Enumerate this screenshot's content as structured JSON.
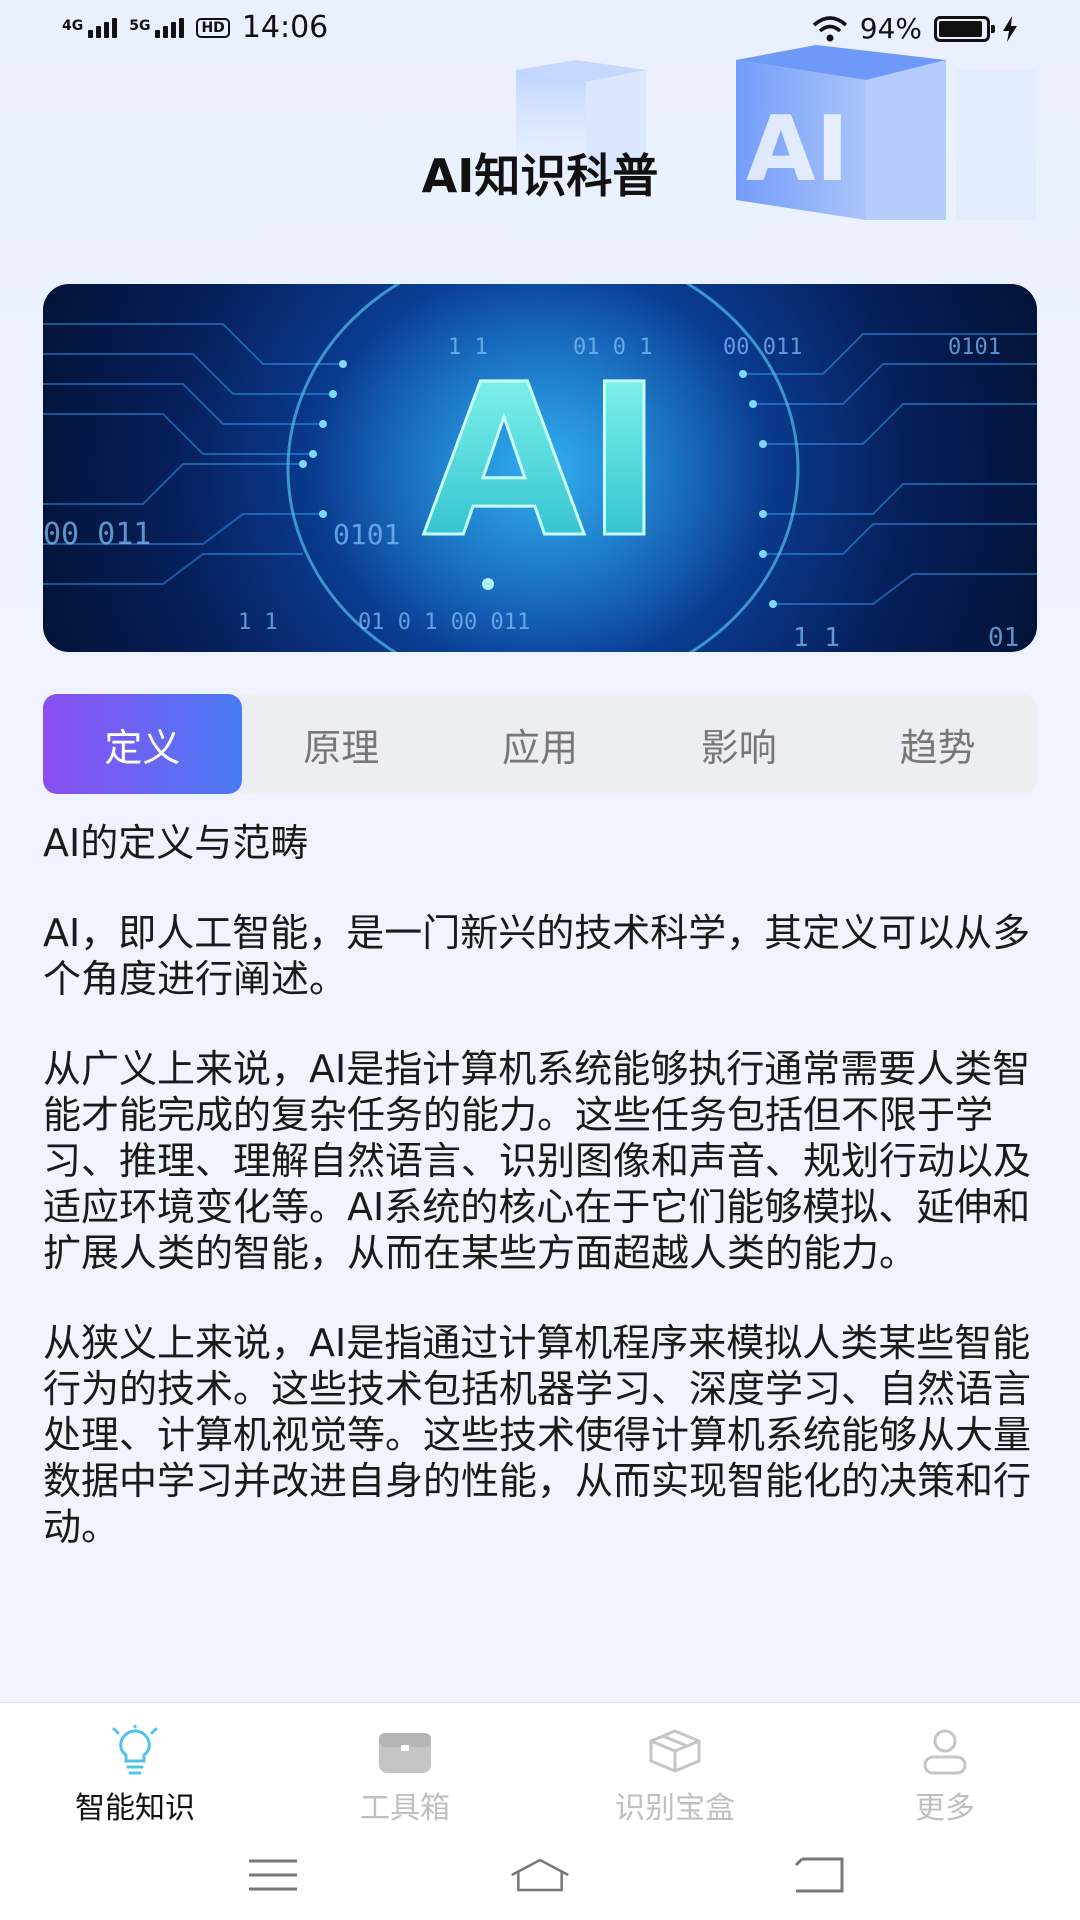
{
  "status_bar": {
    "net1": "4G",
    "net2": "5G",
    "hd": "HD",
    "time": "14:06",
    "battery_pct": "94%",
    "battery_level": 0.94
  },
  "header": {
    "title": "AI知识科普"
  },
  "banner": {
    "main_text": "AI",
    "binary": [
      "1 1",
      "01 0 1",
      "00 011",
      "0101",
      "00 011",
      "0101",
      "1 1",
      "01 0 1 00 011",
      "1 1",
      "01"
    ]
  },
  "tabs": [
    {
      "label": "定义",
      "active": true
    },
    {
      "label": "原理",
      "active": false
    },
    {
      "label": "应用",
      "active": false
    },
    {
      "label": "影响",
      "active": false
    },
    {
      "label": "趋势",
      "active": false
    }
  ],
  "article": {
    "heading": "AI的定义与范畴",
    "paragraphs": [
      "AI，即人工智能，是一门新兴的技术科学，其定义可以从多个角度进行阐述。",
      "从广义上来说，AI是指计算机系统能够执行通常需要人类智能才能完成的复杂任务的能力。这些任务包括但不限于学习、推理、理解自然语言、识别图像和声音、规划行动以及适应环境变化等。AI系统的核心在于它们能够模拟、延伸和扩展人类的智能，从而在某些方面超越人类的能力。",
      "从狭义上来说，AI是指通过计算机程序来模拟人类某些智能行为的技术。这些技术包括机器学习、深度学习、自然语言处理、计算机视觉等。这些技术使得计算机系统能够从大量数据中学习并改进自身的性能，从而实现智能化的决策和行动。"
    ]
  },
  "bottom_nav": [
    {
      "label": "智能知识",
      "icon": "lightbulb-icon",
      "active": true
    },
    {
      "label": "工具箱",
      "icon": "toolbox-icon",
      "active": false
    },
    {
      "label": "识别宝盒",
      "icon": "box-icon",
      "active": false
    },
    {
      "label": "更多",
      "icon": "user-icon",
      "active": false
    }
  ],
  "colors": {
    "tab_active_start": "#8a4df0",
    "tab_active_end": "#4a7cf5",
    "nav_active_icon": "#4fc3e8"
  }
}
